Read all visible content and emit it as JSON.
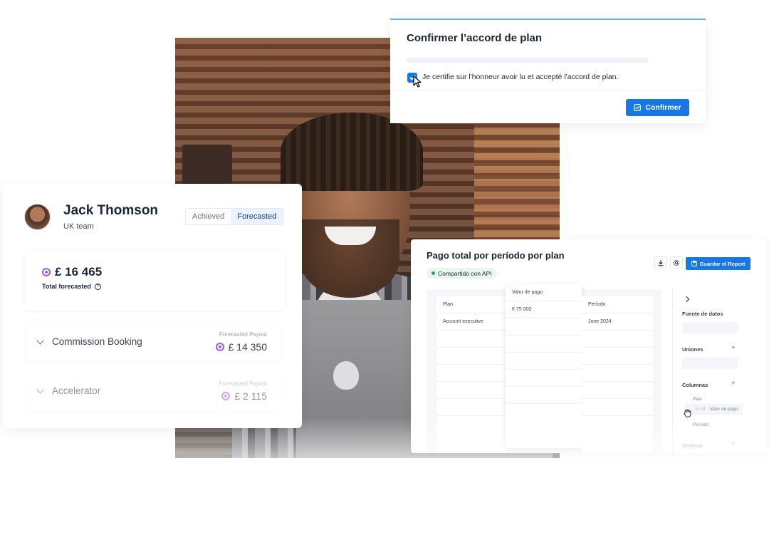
{
  "dialog": {
    "title": "Confirmer l’accord de plan",
    "checkbox_label": "Je certifie sur l'honneur avoir lu et accepté l'accord de plan.",
    "confirm_label": "Confirmer"
  },
  "profile": {
    "name": "Jack Thomson",
    "team": "UK team",
    "tabs": {
      "achieved": "Achieved",
      "forecasted": "Forecasted"
    },
    "total": {
      "value": "£ 16 465",
      "label": "Total forecasted"
    },
    "rows": [
      {
        "label": "Commission Booking",
        "sub": "Forecasted Payout",
        "value": "£ 14 350"
      },
      {
        "label": "Accelerator",
        "sub": "Forecasted Payout",
        "value": "£ 2 115"
      }
    ]
  },
  "report": {
    "title": "Pago total por período por plan",
    "badge": "Compartido con API",
    "save_label": "Guardar el Report",
    "columns": {
      "plan": {
        "header": "Plan",
        "cell": "Account executive"
      },
      "valor": {
        "header": "Valor de pago",
        "cell": "€ 75 000"
      },
      "periodo": {
        "header": "Período",
        "cell": "June 2024"
      }
    },
    "side": {
      "fuente": "Fuente de datos",
      "uniones": "Uniones",
      "columnas": "Columnas",
      "items": [
        "Plan",
        "Valor de pago",
        "Período"
      ],
      "sum": "SUM",
      "ordenar": "Ordenar"
    }
  },
  "colors": {
    "accent": "#1677e5",
    "coin": "#9b5cf6",
    "badge_dot": "#2ea65a"
  },
  "icons": [
    "check-icon",
    "cursor-icon",
    "coin-icon",
    "help-icon",
    "chevron-down-icon",
    "download-icon",
    "settings-icon",
    "save-icon",
    "chevron-right-icon",
    "plus-icon",
    "grab-hand-icon"
  ]
}
